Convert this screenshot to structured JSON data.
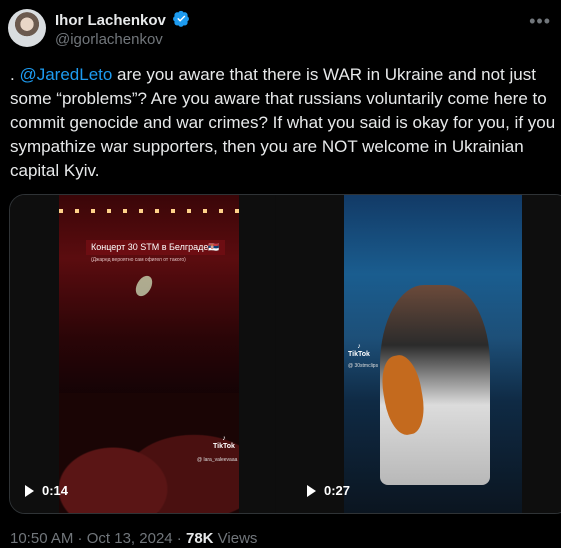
{
  "author": {
    "name": "Ihor Lachenkov",
    "handle": "@igorlachenkov",
    "verified": true
  },
  "tweet": {
    "prefix": ". ",
    "mention": "@JaredLeto",
    "body": " are you aware that there is WAR in Ukraine and not just some “problems”? Are you aware that russians voluntarily come here to commit genocide and war crimes? If what you said is okay for you, if you sympathize war supporters, then you are NOT welcome in Ukrainian capital Kyiv."
  },
  "media": [
    {
      "overlay_title": "Концерт 30 STM в Белграде🇷🇸",
      "overlay_subtitle": "(Джаред вероятно сам офигел от такого)",
      "watermark": "TikTok",
      "watermark_handle": "@ lara_valeevaaa",
      "duration": "0:14"
    },
    {
      "watermark": "TikTok",
      "watermark_handle": "@ 30stmclips",
      "duration": "0:27"
    }
  ],
  "footer": {
    "time": "10:50 AM",
    "separator": " · ",
    "date": "Oct 13, 2024",
    "views_count": "78K",
    "views_label": " Views"
  },
  "colors": {
    "background": "#000000",
    "text": "#e7e9ea",
    "secondary": "#71767b",
    "accent": "#1d9bf0"
  },
  "icons": [
    "verified-badge-icon",
    "more-icon",
    "play-icon",
    "tiktok-icon"
  ]
}
